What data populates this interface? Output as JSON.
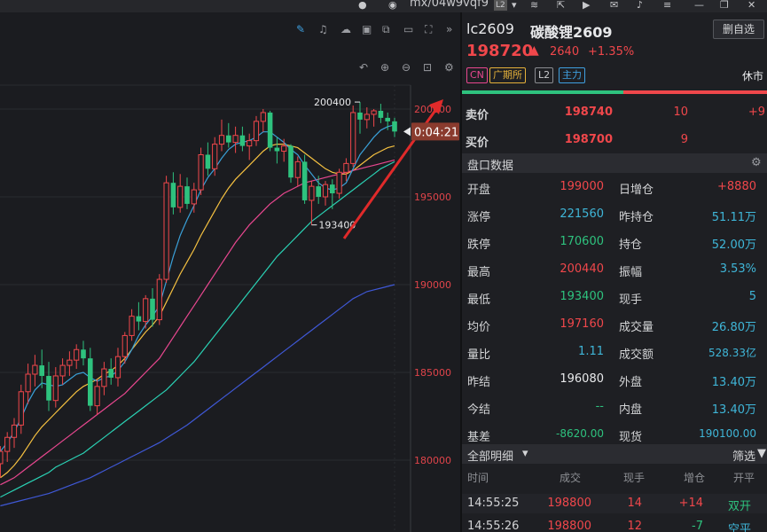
{
  "window": {
    "title_text": "mx/04w9vqf9",
    "badge": "L2"
  },
  "chart": {
    "y_axis_labels": [
      "200000",
      "195000",
      "190000",
      "185000",
      "180000"
    ],
    "high_marker": "200400",
    "low_marker": "193400",
    "countdown": "0:04:21",
    "accent_up": "#f0474b",
    "accent_down": "#2ec27e"
  },
  "chart_data": {
    "type": "candlestick",
    "ylim": [
      177500,
      202500
    ],
    "y_ticks": [
      200000,
      195000,
      190000,
      185000,
      180000
    ],
    "candles": [
      {
        "o": 179800,
        "h": 180800,
        "l": 179000,
        "c": 180500
      },
      {
        "o": 180500,
        "h": 181600,
        "l": 179900,
        "c": 181300
      },
      {
        "o": 181300,
        "h": 182400,
        "l": 180700,
        "c": 182000
      },
      {
        "o": 182000,
        "h": 184300,
        "l": 181500,
        "c": 183900
      },
      {
        "o": 183900,
        "h": 185500,
        "l": 183200,
        "c": 184900
      },
      {
        "o": 184900,
        "h": 186000,
        "l": 184200,
        "c": 185400
      },
      {
        "o": 185400,
        "h": 186300,
        "l": 184100,
        "c": 184800
      },
      {
        "o": 184800,
        "h": 185600,
        "l": 182800,
        "c": 183400
      },
      {
        "o": 183400,
        "h": 185300,
        "l": 183000,
        "c": 184800
      },
      {
        "o": 184800,
        "h": 185800,
        "l": 184300,
        "c": 185400
      },
      {
        "o": 185400,
        "h": 186200,
        "l": 184800,
        "c": 185700
      },
      {
        "o": 185700,
        "h": 186600,
        "l": 185200,
        "c": 186300
      },
      {
        "o": 186300,
        "h": 186800,
        "l": 185400,
        "c": 185800
      },
      {
        "o": 185800,
        "h": 186400,
        "l": 182800,
        "c": 183100
      },
      {
        "o": 183100,
        "h": 184600,
        "l": 182600,
        "c": 184200
      },
      {
        "o": 184200,
        "h": 185600,
        "l": 183700,
        "c": 185200
      },
      {
        "o": 185200,
        "h": 185800,
        "l": 184300,
        "c": 184700
      },
      {
        "o": 184700,
        "h": 186400,
        "l": 184200,
        "c": 185900
      },
      {
        "o": 185900,
        "h": 187300,
        "l": 185500,
        "c": 187100
      },
      {
        "o": 187100,
        "h": 188600,
        "l": 186800,
        "c": 188200
      },
      {
        "o": 188200,
        "h": 189000,
        "l": 187400,
        "c": 187900
      },
      {
        "o": 187900,
        "h": 189400,
        "l": 187500,
        "c": 189200
      },
      {
        "o": 189200,
        "h": 189800,
        "l": 187600,
        "c": 188000
      },
      {
        "o": 188000,
        "h": 190600,
        "l": 187700,
        "c": 190300
      },
      {
        "o": 190300,
        "h": 196200,
        "l": 190100,
        "c": 195800
      },
      {
        "o": 195800,
        "h": 196400,
        "l": 194000,
        "c": 194400
      },
      {
        "o": 194400,
        "h": 196300,
        "l": 194100,
        "c": 195600
      },
      {
        "o": 195600,
        "h": 196100,
        "l": 194300,
        "c": 194600
      },
      {
        "o": 194600,
        "h": 195800,
        "l": 194100,
        "c": 195400
      },
      {
        "o": 195400,
        "h": 197800,
        "l": 195100,
        "c": 197400
      },
      {
        "o": 197400,
        "h": 198100,
        "l": 196200,
        "c": 196600
      },
      {
        "o": 196600,
        "h": 198400,
        "l": 196200,
        "c": 198000
      },
      {
        "o": 198000,
        "h": 199400,
        "l": 197600,
        "c": 198500
      },
      {
        "o": 198500,
        "h": 199200,
        "l": 197800,
        "c": 198100
      },
      {
        "o": 198100,
        "h": 199000,
        "l": 197500,
        "c": 198500
      },
      {
        "o": 198500,
        "h": 199000,
        "l": 197600,
        "c": 197900
      },
      {
        "o": 197900,
        "h": 198600,
        "l": 197100,
        "c": 198200
      },
      {
        "o": 198200,
        "h": 199600,
        "l": 197900,
        "c": 199300
      },
      {
        "o": 199300,
        "h": 200000,
        "l": 198700,
        "c": 199800
      },
      {
        "o": 199800,
        "h": 199900,
        "l": 197600,
        "c": 197800
      },
      {
        "o": 197800,
        "h": 198400,
        "l": 196900,
        "c": 197600
      },
      {
        "o": 197600,
        "h": 198300,
        "l": 197000,
        "c": 197900
      },
      {
        "o": 197900,
        "h": 198000,
        "l": 195800,
        "c": 196100
      },
      {
        "o": 196100,
        "h": 197300,
        "l": 195600,
        "c": 197000
      },
      {
        "o": 197000,
        "h": 197400,
        "l": 194600,
        "c": 194800
      },
      {
        "o": 194800,
        "h": 195900,
        "l": 193400,
        "c": 195600
      },
      {
        "o": 195600,
        "h": 196200,
        "l": 194600,
        "c": 195000
      },
      {
        "o": 195000,
        "h": 195900,
        "l": 194500,
        "c": 195700
      },
      {
        "o": 195700,
        "h": 196000,
        "l": 194300,
        "c": 195200
      },
      {
        "o": 195200,
        "h": 196600,
        "l": 194900,
        "c": 196400
      },
      {
        "o": 196400,
        "h": 197200,
        "l": 195900,
        "c": 196900
      },
      {
        "o": 196900,
        "h": 200200,
        "l": 196700,
        "c": 199800
      },
      {
        "o": 199800,
        "h": 200400,
        "l": 198600,
        "c": 199400
      },
      {
        "o": 199400,
        "h": 200100,
        "l": 198900,
        "c": 199700
      },
      {
        "o": 199700,
        "h": 200000,
        "l": 199000,
        "c": 199900
      },
      {
        "o": 199900,
        "h": 200300,
        "l": 199200,
        "c": 199500
      },
      {
        "o": 199500,
        "h": 199800,
        "l": 198800,
        "c": 199300
      },
      {
        "o": 199300,
        "h": 199500,
        "l": 198400,
        "c": 198720
      }
    ],
    "ma_lines": [
      {
        "color": "#f5c141",
        "values": [
          179000,
          179300,
          179700,
          180200,
          180800,
          181400,
          181900,
          182300,
          182700,
          183100,
          183500,
          183900,
          184200,
          184400,
          184600,
          184900,
          185100,
          185400,
          185800,
          186300,
          186800,
          187300,
          187700,
          188200,
          189000,
          189800,
          190600,
          191300,
          192000,
          192800,
          193500,
          194200,
          194900,
          195500,
          196000,
          196400,
          196800,
          197200,
          197600,
          197900,
          198000,
          198000,
          197900,
          197800,
          197500,
          197200,
          196900,
          196600,
          196400,
          196300,
          196300,
          196500,
          196800,
          197100,
          197400,
          197600,
          197800,
          197900
        ]
      },
      {
        "color": "#e8478f",
        "values": [
          178600,
          178800,
          179000,
          179300,
          179600,
          179900,
          180200,
          180500,
          180800,
          181100,
          181400,
          181700,
          182000,
          182300,
          182600,
          182900,
          183200,
          183500,
          183800,
          184200,
          184600,
          185000,
          185400,
          185800,
          186400,
          187000,
          187600,
          188200,
          188800,
          189400,
          190000,
          190600,
          191200,
          191800,
          192400,
          192900,
          193400,
          193800,
          194200,
          194600,
          194900,
          195200,
          195400,
          195600,
          195800,
          195900,
          196000,
          196100,
          196200,
          196300,
          196400,
          196500,
          196600,
          196700,
          196800,
          196900,
          197000,
          197100
        ]
      },
      {
        "color": "#3aa0d8",
        "values": [
          180500,
          181000,
          181600,
          182400,
          183300,
          184000,
          184400,
          184300,
          184200,
          184300,
          184600,
          184900,
          185000,
          184700,
          184500,
          184700,
          184800,
          185100,
          185600,
          186300,
          187100,
          187700,
          188200,
          188800,
          190200,
          191600,
          192800,
          193700,
          194500,
          195400,
          196100,
          196600,
          197200,
          197700,
          198000,
          198100,
          198200,
          198400,
          198700,
          198700,
          198400,
          198100,
          197700,
          197400,
          196800,
          196300,
          195800,
          195500,
          195400,
          195500,
          195800,
          196600,
          197400,
          197900,
          198400,
          198800,
          199000,
          199100
        ]
      },
      {
        "color": "#2ad1b4",
        "values": [
          177900,
          178100,
          178300,
          178500,
          178700,
          178900,
          179100,
          179300,
          179600,
          179800,
          180000,
          180200,
          180400,
          180700,
          181000,
          181300,
          181600,
          181900,
          182200,
          182500,
          182800,
          183100,
          183400,
          183700,
          184000,
          184400,
          184800,
          185200,
          185600,
          186100,
          186600,
          187100,
          187600,
          188100,
          188600,
          189100,
          189600,
          190100,
          190600,
          191100,
          191600,
          192000,
          192400,
          192800,
          193200,
          193600,
          193900,
          194200,
          194500,
          194800,
          195100,
          195400,
          195700,
          196000,
          196300,
          196600,
          196800,
          197000
        ]
      },
      {
        "color": "#3f58d6",
        "values": [
          177400,
          177500,
          177600,
          177700,
          177800,
          177900,
          178000,
          178100,
          178250,
          178400,
          178550,
          178700,
          178850,
          179000,
          179200,
          179400,
          179600,
          179800,
          180000,
          180200,
          180400,
          180600,
          180800,
          181000,
          181250,
          181500,
          181750,
          182000,
          182300,
          182600,
          182900,
          183200,
          183500,
          183800,
          184100,
          184400,
          184700,
          185000,
          185300,
          185600,
          185900,
          186200,
          186500,
          186800,
          187100,
          187400,
          187700,
          188000,
          188300,
          188600,
          188900,
          189200,
          189400,
          189600,
          189700,
          189800,
          189900,
          190000
        ]
      }
    ]
  },
  "quote": {
    "symbol": "lc2609",
    "name": "碳酸锂2609",
    "delete_btn": "删自选",
    "price": "198720",
    "change": "2640",
    "change_pct": "+1.35%",
    "tags": [
      "CN",
      "广期所",
      "L2",
      "主力"
    ],
    "status": "休市",
    "ask": {
      "label": "卖价",
      "price": "198740",
      "vol": "10",
      "chg": "+9"
    },
    "bid": {
      "label": "买价",
      "price": "198700",
      "vol": "9"
    },
    "section_title": "盘口数据",
    "stats_left": [
      {
        "label": "开盘",
        "value": "199000"
      },
      {
        "label": "涨停",
        "value": "221560"
      },
      {
        "label": "跌停",
        "value": "170600"
      },
      {
        "label": "最高",
        "value": "200440"
      },
      {
        "label": "最低",
        "value": "193400"
      },
      {
        "label": "均价",
        "value": "197160"
      },
      {
        "label": "量比",
        "value": "1.11"
      },
      {
        "label": "昨结",
        "value": "196080"
      },
      {
        "label": "今结",
        "value": "--"
      },
      {
        "label": "基差",
        "value": "-8620.00"
      }
    ],
    "stats_right": [
      {
        "label": "日增仓",
        "value": "+8880"
      },
      {
        "label": "昨持仓",
        "value": "51.11万"
      },
      {
        "label": "持仓",
        "value": "52.00万"
      },
      {
        "label": "振幅",
        "value": "3.53%"
      },
      {
        "label": "现手",
        "value": "5"
      },
      {
        "label": "成交量",
        "value": "26.80万"
      },
      {
        "label": "成交额",
        "value": "528.33亿"
      },
      {
        "label": "外盘",
        "value": "13.40万"
      },
      {
        "label": "内盘",
        "value": "13.40万"
      },
      {
        "label": "现货",
        "value": "190100.00"
      }
    ],
    "trades_title": "全部明细",
    "filter_label": "筛选",
    "trade_headers": [
      "时间",
      "成交",
      "现手",
      "增仓",
      "开平"
    ],
    "trades": [
      {
        "time": "14:55:25",
        "price": "198800",
        "qty": "14",
        "oi": "+14",
        "type": "双开"
      },
      {
        "time": "14:55:26",
        "price": "198800",
        "qty": "12",
        "oi": "-7",
        "type": "空平"
      }
    ]
  }
}
